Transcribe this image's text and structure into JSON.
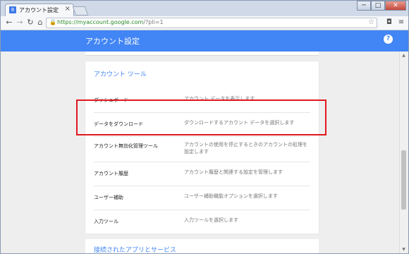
{
  "browser": {
    "tab_title": "アカウント設定",
    "favicon": "8",
    "tab_close": "×",
    "url_host": "https://myaccount.google.com",
    "url_path": "/?pli=1",
    "win_min": "─",
    "win_max": "□",
    "win_close": "✕"
  },
  "header": {
    "title": "アカウント設定",
    "help_label": "?"
  },
  "tools_section": {
    "title": "アカウント ツール",
    "rows": [
      {
        "label": "ダッシュボード",
        "desc": "アカウント データを表示します"
      },
      {
        "label": "データをダウンロード",
        "desc": "ダウンロードするアカウント データを選択します"
      },
      {
        "label": "アカウント無効化管理ツール",
        "desc": "アカウントの使用を停止するときのアカウントの処理を設定します"
      },
      {
        "label": "アカウント履歴",
        "desc": "アカウント履歴と関連する設定を管理します"
      },
      {
        "label": "ユーザー補助",
        "desc": "ユーザー補助機能オプションを選択します"
      },
      {
        "label": "入力ツール",
        "desc": "入力ツールを選択します"
      }
    ]
  },
  "next_section": {
    "title": "接続されたアプリとサービス"
  },
  "colors": {
    "accent": "#4285f4",
    "highlight": "#e0181e"
  }
}
